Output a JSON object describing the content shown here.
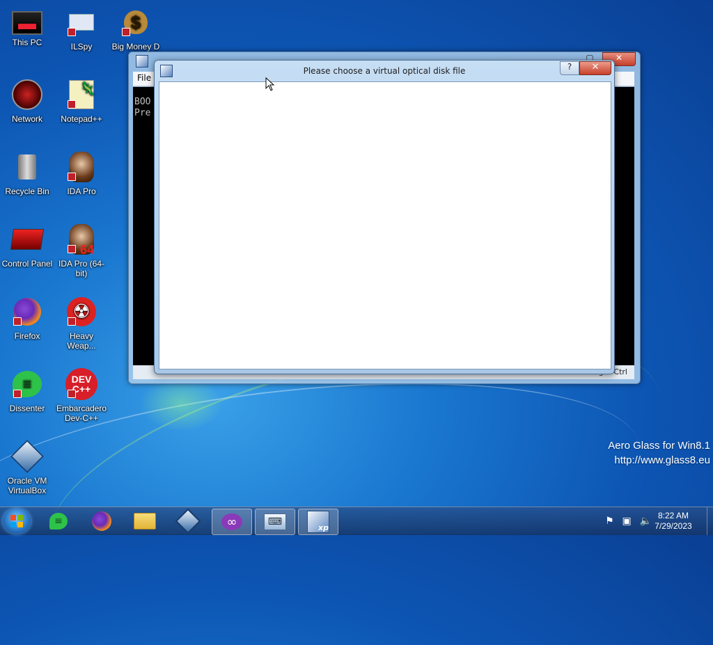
{
  "desktop": {
    "icons": [
      {
        "label": "This PC",
        "glyph": "🖥",
        "icon": "computer-icon"
      },
      {
        "label": "ILSpy",
        "glyph": "⚙",
        "icon": "ilspy-icon"
      },
      {
        "label": "Big Money D",
        "glyph": "$",
        "icon": "money-bag-icon"
      },
      {
        "label": "Network",
        "glyph": "◉",
        "icon": "network-icon"
      },
      {
        "label": "Notepad++",
        "glyph": "📝",
        "icon": "notepad-plus-plus-icon"
      },
      {
        "label": "Recycle Bin",
        "glyph": "🗑",
        "icon": "recycle-bin-icon"
      },
      {
        "label": "IDA Pro",
        "glyph": "👤",
        "icon": "ida-pro-icon"
      },
      {
        "label": "Control Panel",
        "glyph": "▣",
        "icon": "control-panel-icon"
      },
      {
        "label": "IDA Pro (64-bit)",
        "glyph": "👤",
        "icon": "ida-pro-64-icon"
      },
      {
        "label": "Firefox",
        "glyph": "🦊",
        "icon": "firefox-icon"
      },
      {
        "label": "Heavy Weap...",
        "glyph": "☢",
        "icon": "radiation-icon"
      },
      {
        "label": "Dissenter",
        "glyph": "💬",
        "icon": "dissenter-icon"
      },
      {
        "label": "Embarcadero Dev-C++",
        "glyph": "DEV",
        "icon": "dev-cpp-icon"
      },
      {
        "label": "Oracle VM VirtualBox",
        "glyph": "⬢",
        "icon": "virtualbox-icon"
      }
    ]
  },
  "vbox_window": {
    "menu": [
      "File"
    ],
    "screen_lines": [
      "BOO",
      "Pre"
    ],
    "status_host": "Right Ctrl"
  },
  "dialog": {
    "title": "Please choose a virtual optical disk file",
    "help_label": "?",
    "close_label": "✕"
  },
  "watermark": {
    "line1": "Aero Glass for Win8.1",
    "line2": "http://www.glass8.eu"
  },
  "taskbar": {
    "buttons": [
      {
        "name": "dissenter",
        "glyph": "▤",
        "color": "#33c24d"
      },
      {
        "name": "firefox",
        "glyph": "●",
        "color": "#f28a1c"
      },
      {
        "name": "explorer",
        "glyph": "📁",
        "color": "#f2c34a"
      },
      {
        "name": "virtualbox",
        "glyph": "⬢",
        "color": "#d8e4f0"
      },
      {
        "name": "purple-app",
        "glyph": "∞",
        "color": "#8a3ab8"
      },
      {
        "name": "keyboard-app",
        "glyph": "⌨",
        "color": "#cfe0f4"
      },
      {
        "name": "xp-vm",
        "glyph": "xp",
        "color": "#dfe8f4"
      }
    ],
    "time": "8:22 AM",
    "date": "7/29/2023"
  }
}
